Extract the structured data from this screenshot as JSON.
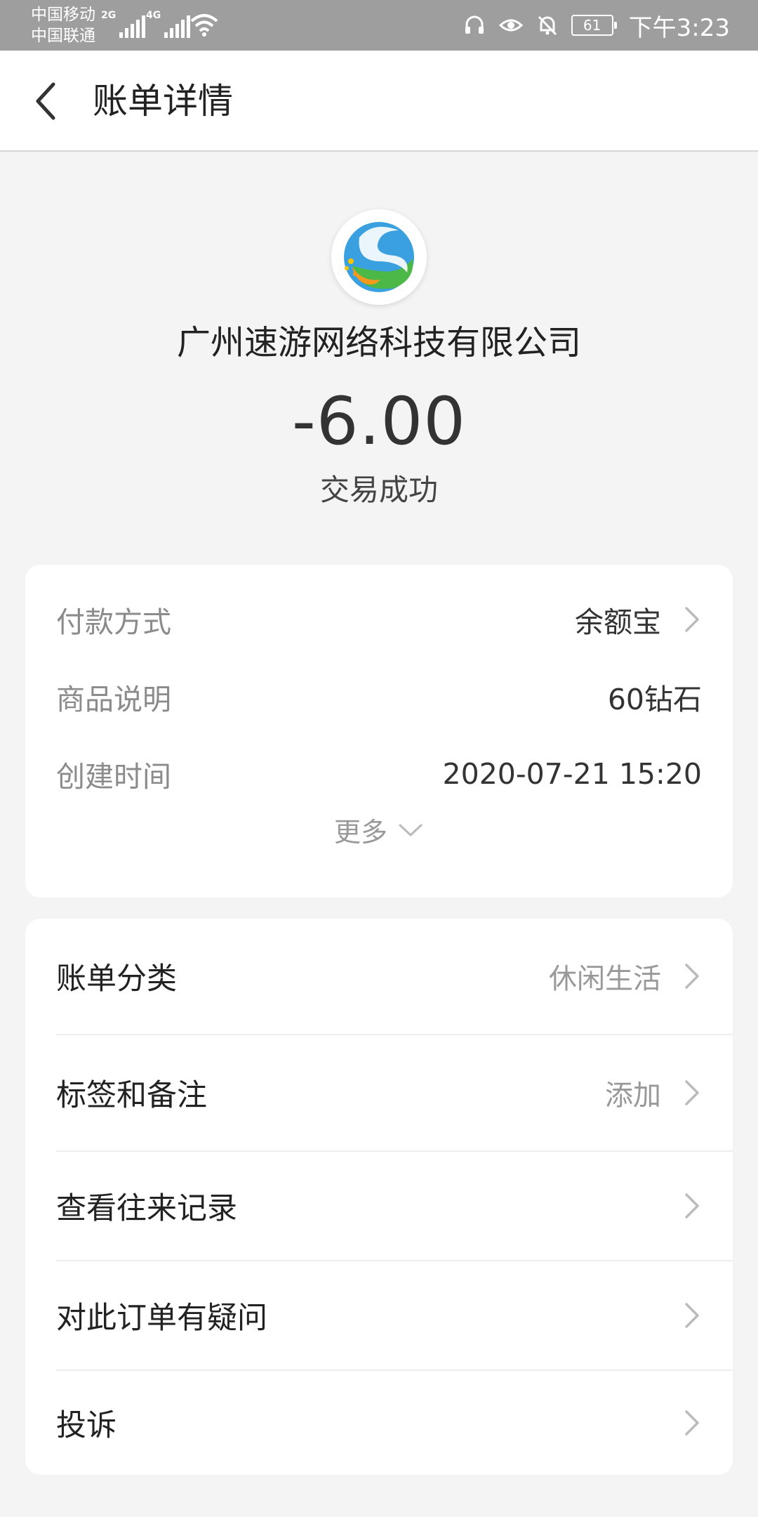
{
  "status_bar": {
    "carrier1": "中国移动",
    "carrier2": "中国联通",
    "net1": "2G",
    "net2": "4G",
    "battery": "61",
    "time": "下午3:23"
  },
  "header": {
    "title": "账单详情"
  },
  "merchant": {
    "name": "广州速游网络科技有限公司",
    "amount": "-6.00",
    "status": "交易成功"
  },
  "details": {
    "payment_label": "付款方式",
    "payment_value": "余额宝",
    "item_label": "商品说明",
    "item_value": "60钻石",
    "time_label": "创建时间",
    "time_value": "2020-07-21 15:20",
    "more_label": "更多"
  },
  "actions": {
    "category_label": "账单分类",
    "category_value": "休闲生活",
    "tags_label": "标签和备注",
    "tags_value": "添加",
    "history_label": "查看往来记录",
    "question_label": "对此订单有疑问",
    "complaint_label": "投诉"
  },
  "colors": {
    "status_bar": "#9e9e9e",
    "background": "#f4f4f4",
    "card": "#ffffff"
  }
}
